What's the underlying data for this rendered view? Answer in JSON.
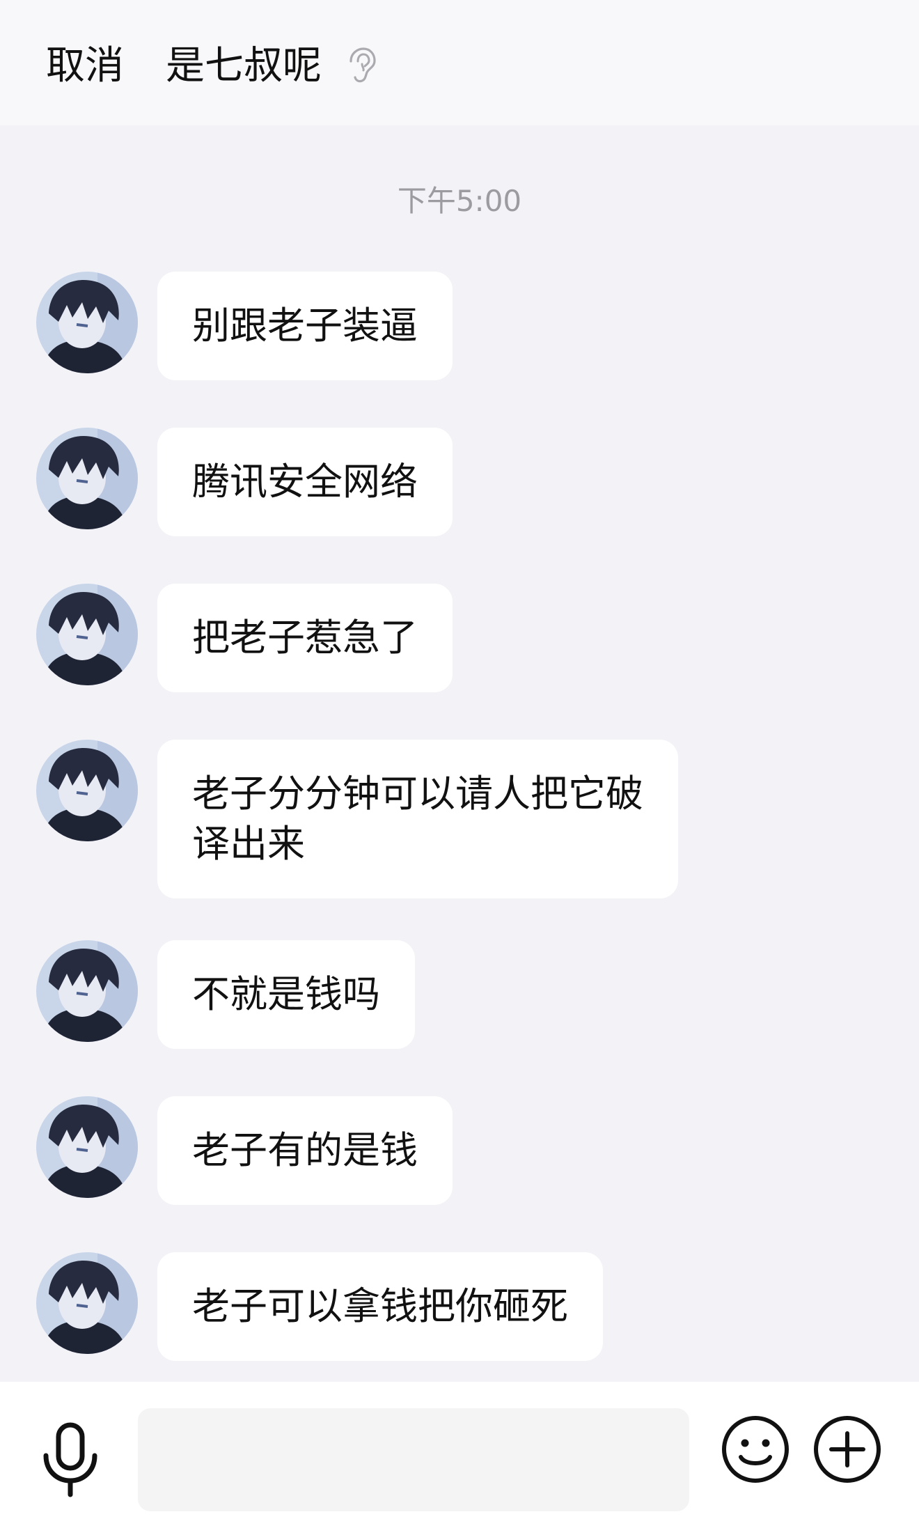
{
  "header": {
    "cancel_label": "取消",
    "contact_name": "是七叔呢",
    "voice_mode_icon": "ear-icon"
  },
  "chat": {
    "timestamp": "下午5:00",
    "messages": [
      {
        "text": "别跟老子装逼"
      },
      {
        "text": "腾讯安全网络"
      },
      {
        "text": "把老子惹急了"
      },
      {
        "text": "老子分分钟可以请人把它破\n译出来"
      },
      {
        "text": "不就是钱吗"
      },
      {
        "text": "老子有的是钱"
      },
      {
        "text": "老子可以拿钱把你砸死"
      }
    ]
  },
  "input_bar": {
    "voice_icon": "microphone-icon",
    "text_value": "",
    "emoji_icon": "emoji-icon",
    "more_icon": "plus-circle-icon"
  },
  "colors": {
    "background": "#f3f2f7",
    "bubble": "#ffffff",
    "timestamp": "#9b9ba0"
  }
}
